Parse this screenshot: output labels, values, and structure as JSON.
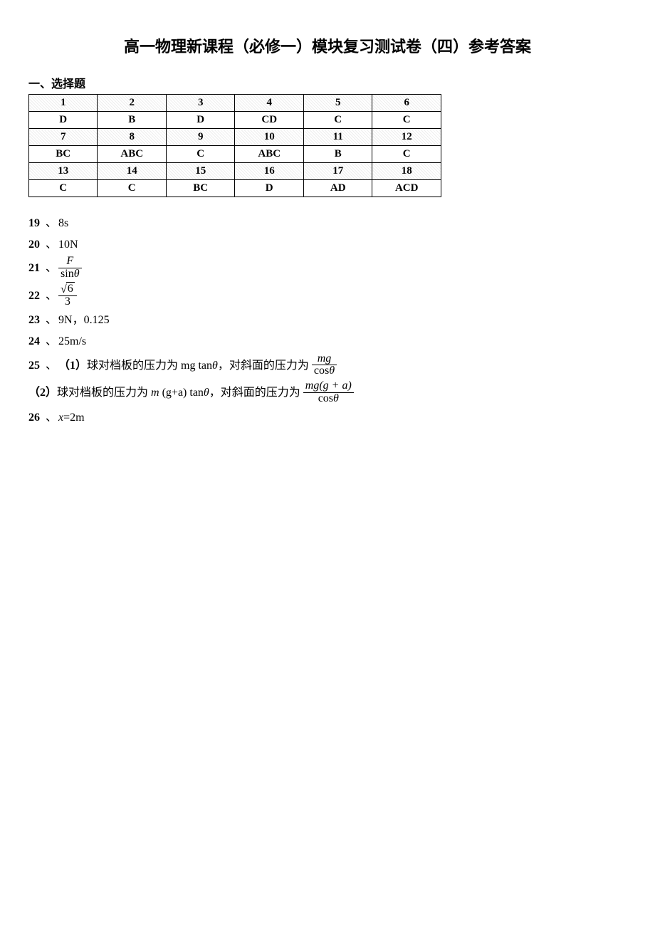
{
  "title": "高一物理新课程（必修一）模块复习测试卷（四）参考答案",
  "sectionHead": "一、选择题",
  "mcq": {
    "rows": [
      {
        "nums": [
          "1",
          "2",
          "3",
          "4",
          "5",
          "6"
        ],
        "ans": [
          "D",
          "B",
          "D",
          "CD",
          "C",
          "C"
        ]
      },
      {
        "nums": [
          "7",
          "8",
          "9",
          "10",
          "11",
          "12"
        ],
        "ans": [
          "BC",
          "ABC",
          "C",
          "ABC",
          "B",
          "C"
        ]
      },
      {
        "nums": [
          "13",
          "14",
          "15",
          "16",
          "17",
          "18"
        ],
        "ans": [
          "C",
          "C",
          "BC",
          "D",
          "AD",
          "ACD"
        ]
      }
    ]
  },
  "free": {
    "sep": "、",
    "q19": {
      "n": "19",
      "ans": "8s"
    },
    "q20": {
      "n": "20",
      "ans": "10N"
    },
    "q21": {
      "n": "21",
      "num": "F",
      "den_sin": "sin",
      "den_th": "θ"
    },
    "q22": {
      "n": "22",
      "num_rad": "6",
      "den": "3"
    },
    "q23": {
      "n": "23",
      "ans": "9N，0.125"
    },
    "q24": {
      "n": "24",
      "ans": "25m/s"
    },
    "q25": {
      "n": "25",
      "p1_label": "（1）",
      "p1_t1": "球对档板的压力为 mg ",
      "p1_tan": "tan",
      "p1_th": "θ",
      "p1_t2": "，对斜面的压力为",
      "p1_frac_num": "mg",
      "p1_frac_den_cos": "cos",
      "p1_frac_den_th": "θ",
      "p2_label": "（2）",
      "p2_t1": "球对档板的压力为 ",
      "p2_m": "m ",
      "p2_ga": "(g+a) ",
      "p2_tan": "tan",
      "p2_th": "θ",
      "p2_t2": "，对斜面的压力为",
      "p2_frac_num": "mg(g + a)",
      "p2_frac_den_cos": "cos",
      "p2_frac_den_th": "θ"
    },
    "q26": {
      "n": "26",
      "var": "x",
      "eq": "=2m"
    }
  }
}
